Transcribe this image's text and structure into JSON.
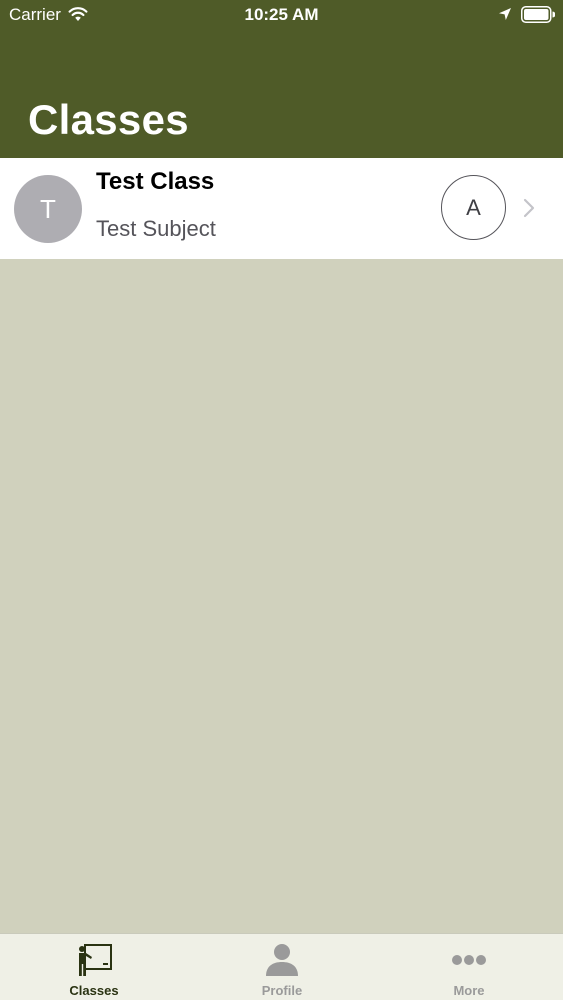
{
  "status_bar": {
    "carrier": "Carrier",
    "time": "10:25 AM",
    "icons": [
      "wifi-icon",
      "location-icon",
      "battery-icon"
    ]
  },
  "header": {
    "title": "Classes"
  },
  "classes": [
    {
      "avatar_letter": "T",
      "title": "Test Class",
      "subtitle": "Test Subject",
      "action_label": "A"
    }
  ],
  "tab_bar": {
    "tabs": [
      {
        "label": "Classes",
        "icon": "teacher-board-icon",
        "active": true
      },
      {
        "label": "Profile",
        "icon": "person-icon",
        "active": false
      },
      {
        "label": "More",
        "icon": "more-dots-icon",
        "active": false
      }
    ]
  },
  "colors": {
    "header_bg": "#4f5b28",
    "page_bg": "#d0d1bd",
    "avatar_bg": "#aeadb2",
    "tab_active": "#2a3312",
    "tab_inactive": "#9a9a9a"
  }
}
